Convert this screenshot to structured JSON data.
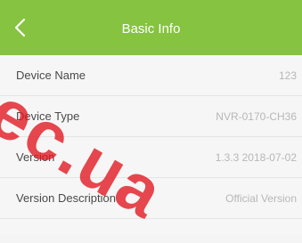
{
  "header": {
    "title": "Basic Info",
    "background_color": "#85c341",
    "back_icon": "chevron-left-icon"
  },
  "rows": [
    {
      "label": "Device Name",
      "value": "123"
    },
    {
      "label": "Device Type",
      "value": "NVR-0170-CH36"
    },
    {
      "label": "Version",
      "value": "1.3.3 2018-07-02"
    },
    {
      "label": "Version Description",
      "value": "Official Version"
    }
  ],
  "watermark": {
    "text": "ec.ua",
    "color": "#e2141e"
  }
}
